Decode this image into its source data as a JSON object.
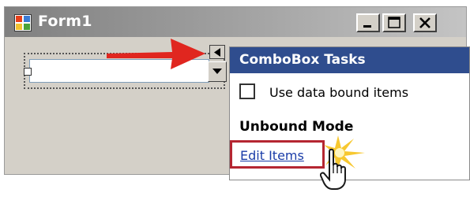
{
  "window": {
    "title": "Form1",
    "minimize_icon": "minimize-icon",
    "maximize_icon": "maximize-icon",
    "close_icon": "close-icon"
  },
  "combobox": {
    "value": "",
    "dropdown_icon": "chevron-down-icon",
    "smart_tag_icon": "smart-tag-arrow-icon"
  },
  "tasks_panel": {
    "title": "ComboBox Tasks",
    "checkbox_label": "Use data bound items",
    "checkbox_checked": false,
    "section_heading": "Unbound Mode",
    "edit_items_link": "Edit Items"
  },
  "annotations": {
    "arrow_icon": "red-arrow-icon",
    "cursor_icon": "hand-pointer-icon",
    "click_burst_icon": "click-burst-icon",
    "highlight_color": "#b52631",
    "arrow_color": "#e0261f"
  },
  "colors": {
    "panel_header": "#2f4d8e",
    "window_bg": "#d4d0c8",
    "link": "#1a3ca8"
  }
}
